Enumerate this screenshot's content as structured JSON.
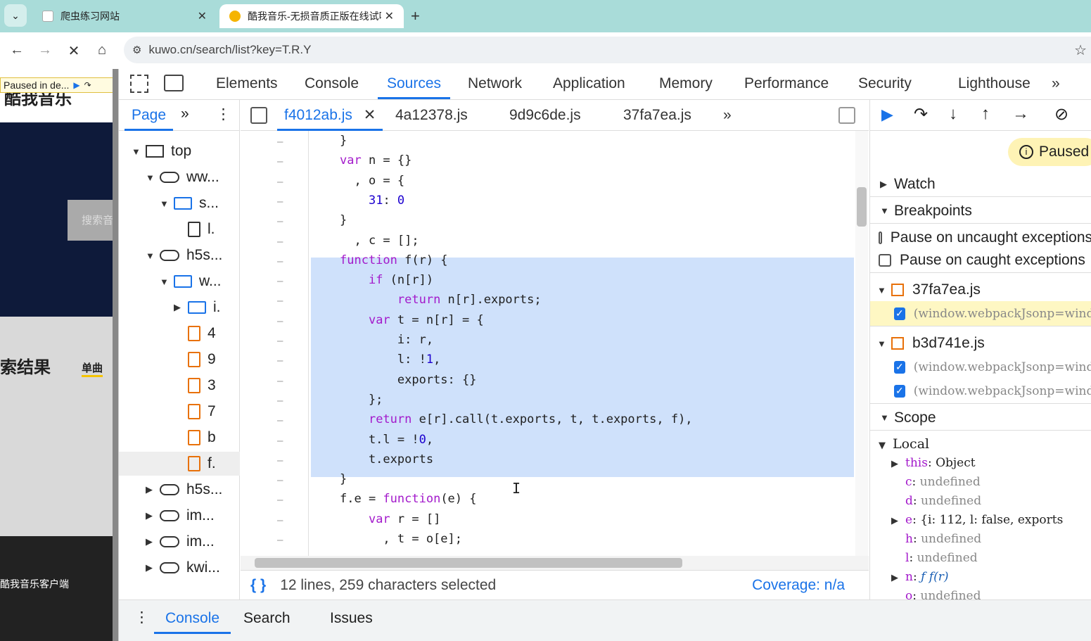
{
  "browser": {
    "tabs": [
      {
        "title": "爬虫练习网站",
        "active": false
      },
      {
        "title": "酷我音乐-无损音质正版在线试听",
        "active": true
      }
    ],
    "url": "kuwo.cn/search/list?key=T.R.Y"
  },
  "page": {
    "paused_label": "Paused in de...",
    "logo_text": "酷我音乐",
    "search_placeholder": "搜索音",
    "results_heading": "索结果",
    "tab_single": "单曲",
    "client_label": "酷我音乐客户端"
  },
  "devtools": {
    "tabs": [
      "Elements",
      "Console",
      "Sources",
      "Network",
      "Application",
      "Memory",
      "Performance",
      "Security",
      "Lighthouse"
    ],
    "active_tab": "Sources",
    "nav": {
      "page_tab": "Page",
      "tree": [
        {
          "label": "top",
          "type": "frame",
          "level": 0,
          "open": true
        },
        {
          "label": "ww...",
          "type": "cloud",
          "level": 1,
          "open": true
        },
        {
          "label": "s...",
          "type": "folder",
          "level": 2,
          "open": true
        },
        {
          "label": "l.",
          "type": "file",
          "level": 3
        },
        {
          "label": "h5s...",
          "type": "cloud",
          "level": 1,
          "open": true
        },
        {
          "label": "w...",
          "type": "folder",
          "level": 2,
          "open": true
        },
        {
          "label": "i.",
          "type": "folder",
          "level": 3,
          "open": false
        },
        {
          "label": "4",
          "type": "jsfile",
          "level": 3
        },
        {
          "label": "9",
          "type": "jsfile",
          "level": 3
        },
        {
          "label": "3",
          "type": "jsfile",
          "level": 3
        },
        {
          "label": "7",
          "type": "jsfile",
          "level": 3
        },
        {
          "label": "b",
          "type": "jsfile",
          "level": 3
        },
        {
          "label": "f.",
          "type": "jsfile",
          "level": 3,
          "selected": true
        },
        {
          "label": "h5s...",
          "type": "cloud",
          "level": 1,
          "open": false
        },
        {
          "label": "im...",
          "type": "cloud",
          "level": 1,
          "open": false
        },
        {
          "label": "im...",
          "type": "cloud",
          "level": 1,
          "open": false
        },
        {
          "label": "kwi...",
          "type": "cloud",
          "level": 1,
          "open": false
        }
      ]
    },
    "editor": {
      "file_tabs": [
        "f4012ab.js",
        "4a12378.js",
        "9d9c6de.js",
        "37fa7ea.js"
      ],
      "active_file": "f4012ab.js",
      "code_lines": [
        "}",
        "var n = {}",
        "  , o = {",
        "    31: 0",
        "}",
        "  , c = [];",
        "function f(r) {",
        "    if (n[r])",
        "        return n[r].exports;",
        "    var t = n[r] = {",
        "        i: r,",
        "        l: !1,",
        "        exports: {}",
        "    };",
        "    return e[r].call(t.exports, t, t.exports, f),",
        "    t.l = !0,",
        "    t.exports",
        "}",
        "f.e = function(e) {",
        "    var r = []",
        "      , t = o[e];"
      ],
      "status": "12 lines, 259 characters selected",
      "coverage": "Coverage: n/a"
    },
    "debugger": {
      "paused_badge": "Paused",
      "watch": "Watch",
      "breakpoints": "Breakpoints",
      "pause_uncaught": "Pause on uncaught exceptions",
      "pause_caught": "Pause on caught exceptions",
      "bp_files": [
        {
          "name": "37fa7ea.js",
          "entries": [
            "(window.webpackJsonp=window.webpackJsonp"
          ]
        },
        {
          "name": "b3d741e.js",
          "entries": [
            "(window.webpackJsonp=window.webpackJsonp",
            "(window.webpackJsonp=window.webpackJsonp"
          ]
        }
      ],
      "scope": "Scope",
      "local": "Local",
      "vars": [
        {
          "name": "this",
          "value": "Object",
          "expandable": true
        },
        {
          "name": "c",
          "value": "undefined"
        },
        {
          "name": "d",
          "value": "undefined"
        },
        {
          "name": "e",
          "value": "{i: 112, l: false, exports",
          "expandable": true
        },
        {
          "name": "h",
          "value": "undefined"
        },
        {
          "name": "l",
          "value": "undefined"
        },
        {
          "name": "n",
          "value": "ƒ f(r)",
          "expandable": true
        },
        {
          "name": "o",
          "value": "undefined"
        }
      ]
    },
    "drawer": {
      "tabs": [
        "Console",
        "Search",
        "Issues"
      ],
      "active": "Console"
    }
  },
  "colors": {
    "accent": "#1a73e8",
    "selection": "#cfe1fb",
    "keyword": "#a31acb",
    "tabstrip": "#a9dcd9"
  }
}
